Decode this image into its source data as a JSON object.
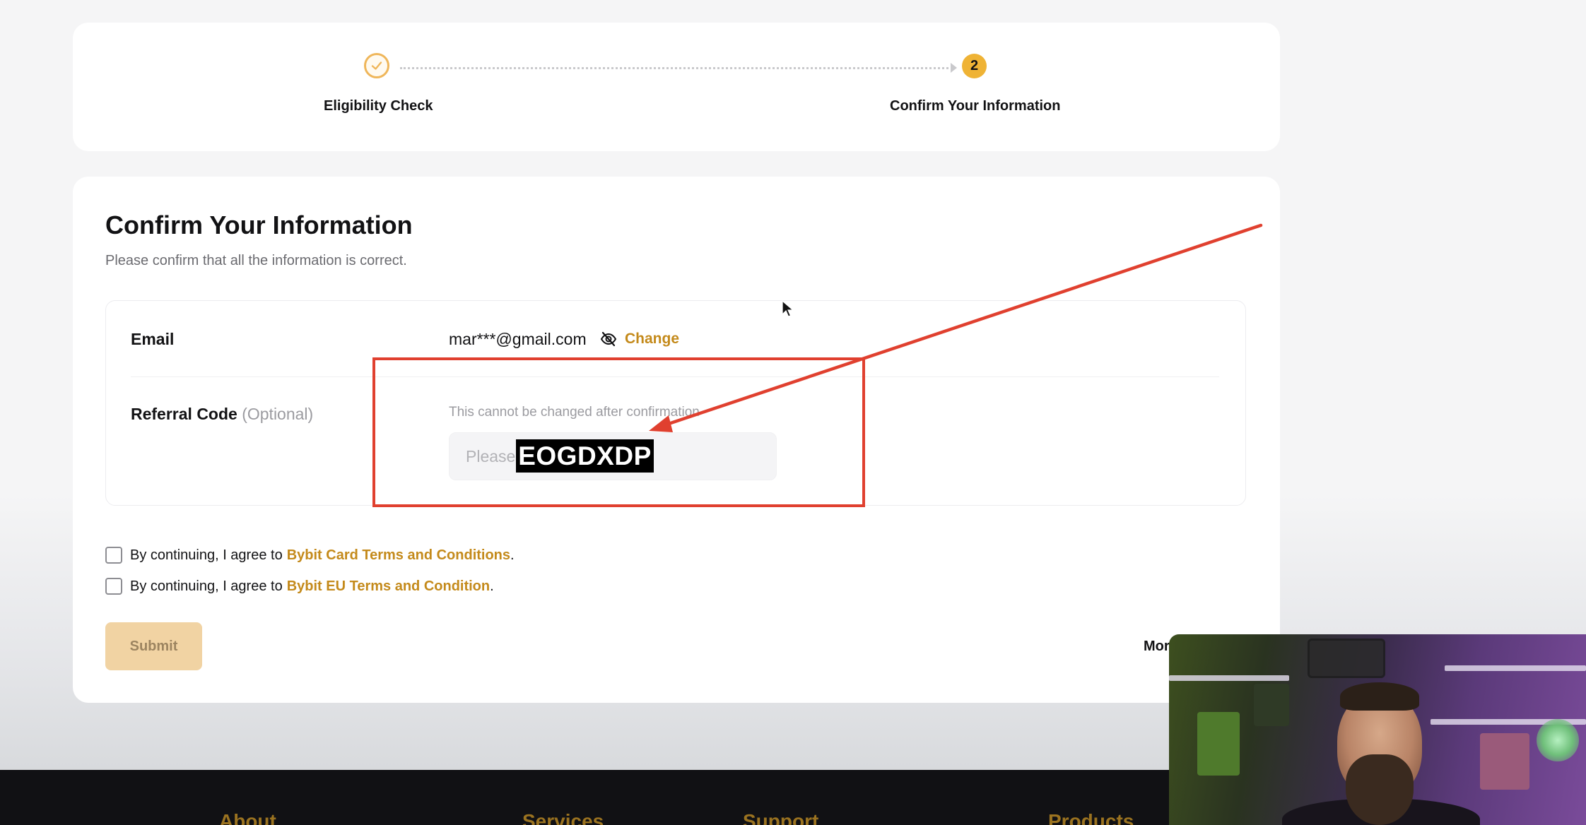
{
  "stepper": {
    "step1_label": "Eligibility Check",
    "step2_number": "2",
    "step2_label": "Confirm Your Information"
  },
  "main": {
    "title": "Confirm Your Information",
    "subtitle": "Please confirm that all the information is correct."
  },
  "email_row": {
    "label": "Email",
    "value": "mar***@gmail.com",
    "change_label": "Change"
  },
  "referral_row": {
    "label": "Referral Code",
    "optional_label": "(Optional)",
    "note": "This cannot be changed after confirmation",
    "placeholder": "Please enter referral code",
    "overlay_code": "EOGDXDP"
  },
  "agreements": [
    {
      "prefix": "By continuing, I agree to",
      "link": "Bybit Card Terms and Conditions",
      "suffix": "."
    },
    {
      "prefix": "By continuing, I agree to",
      "link": "Bybit EU Terms and Condition",
      "suffix": "."
    }
  ],
  "submit_label": "Submit",
  "more_text": "Mor",
  "footer": {
    "columns": [
      "About",
      "Services",
      "Support",
      "Products"
    ]
  },
  "colors": {
    "accent": "#efb335",
    "link": "#c48a1b",
    "annotation_red": "#e0402f",
    "footer_bg": "#111114"
  },
  "icons": {
    "step_done": "check-circle-icon",
    "hide_email": "eye-slash-icon",
    "cursor": "mouse-pointer-icon"
  }
}
